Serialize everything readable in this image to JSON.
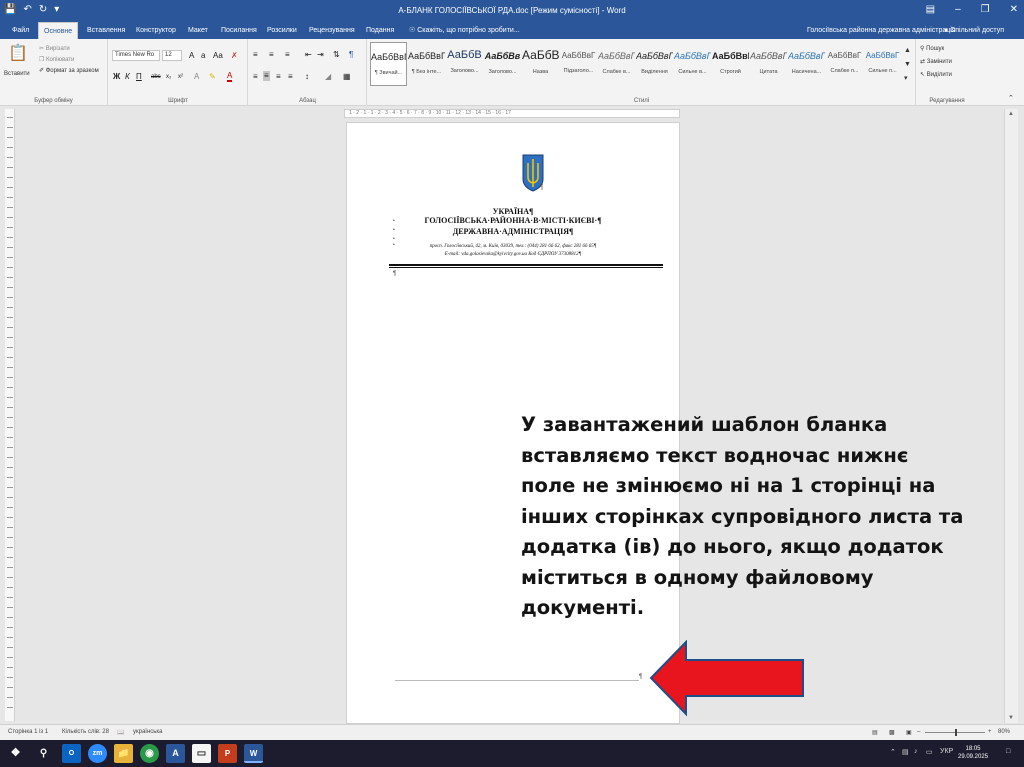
{
  "titlebar": {
    "title": "А-БЛАНК ГОЛОСІЇВСЬКОЇ РДА.doc [Режим сумісності] - Word",
    "save_icon": "save-icon",
    "undo_icon": "undo-icon",
    "redo_icon": "redo-icon",
    "customize_icon": "customize-icon"
  },
  "tabs": {
    "items": [
      "Файл",
      "Основне",
      "Вставлення",
      "Конструктор",
      "Макет",
      "Посилання",
      "Розсилки",
      "Рецензування",
      "Подання"
    ],
    "tellme": "Скажіть, що потрібно зробити...",
    "account": "Голосіївська районна державна адміністрація",
    "share": "Спільний доступ"
  },
  "ribbon": {
    "clipboard": {
      "label": "Буфер обміну",
      "paste": "Вставити",
      "cut": "Вирізати",
      "copy": "Копіювати",
      "format_painter": "Формат за зразком"
    },
    "font": {
      "label": "Шрифт",
      "font_name": "Times New Ro",
      "font_size": "12"
    },
    "paragraph": {
      "label": "Абзац"
    },
    "styles": {
      "label": "Стилі",
      "items": [
        {
          "preview": "АаБбВвГ",
          "name": "¶ Звичай..."
        },
        {
          "preview": "АаБбВвГ",
          "name": "¶ Без інте..."
        },
        {
          "preview": "АаБбВ",
          "name": "Заголово..."
        },
        {
          "preview": "АаБбВв",
          "name": "Заголово..."
        },
        {
          "preview": "АаБбВ",
          "name": "Назва"
        },
        {
          "preview": "АаБбВвГ",
          "name": "Підзаголо..."
        },
        {
          "preview": "АаБбВвГ",
          "name": "Слабке в..."
        },
        {
          "preview": "АаБбВвГ",
          "name": "Виділення"
        },
        {
          "preview": "АаБбВвГ",
          "name": "Сильне в..."
        },
        {
          "preview": "АаБбВвГ",
          "name": "Строгий"
        },
        {
          "preview": "АаБбВвГ",
          "name": "Цитата"
        },
        {
          "preview": "АаБбВвГ",
          "name": "Насичена..."
        },
        {
          "preview": "АаБбВвГ",
          "name": "Слабке п..."
        },
        {
          "preview": "АаБбВвГ",
          "name": "Сильне п..."
        }
      ]
    },
    "editing": {
      "label": "Редагування",
      "find": "Пошук",
      "replace": "Замінити",
      "select": "Виділити"
    }
  },
  "ruler": {
    "numbers": "1 · 2 · 1 · 1 · 2 · 3 · 4 · 5 · 6 · 7 · 8 · 9 · 10 · 11 · 12 · 13 · 14 · 15 · 16 · 17"
  },
  "document": {
    "line1": "УКРАЇНА¶",
    "line2": "ГОЛОСІЇВСЬКА·РАЙОННА·В·МІСТІ·КИЄВІ·¶",
    "line3": "ДЕРЖАВНА·АДМІНІСТРАЦІЯ¶",
    "line4": "просп. Голосіївський, 42, м. Київ, 03039, тел.: (044) 281 66 62, факс 281 66 65¶",
    "line5": "E-mail: vda.golosievska@kyivcity.gov.ua Код ЄДРПОУ 37308812¶",
    "pilcrow": "¶",
    "footer_pilcrow": "¶"
  },
  "overlay": {
    "lines": [
      "У завантажений шаблон бланка",
      "вставляємо текст  водночас нижнє",
      "поле не змінюємо  ні на 1 сторінці на",
      "інших сторінках супровідного листа та",
      "додатка (ів) до нього, якщо додаток",
      "міститься в одному файловому",
      "документі."
    ],
    "arrow_color": "#e8141e"
  },
  "status": {
    "page": "Сторінка 1 із 1",
    "words": "Кількість слів: 28",
    "language": "українська",
    "zoom": "80%"
  },
  "taskbar": {
    "language": "УКР",
    "time": "18:05",
    "date": "29.09.2025"
  },
  "colors": {
    "word_blue": "#2b579a",
    "taskbar": "#1c1c2e"
  }
}
